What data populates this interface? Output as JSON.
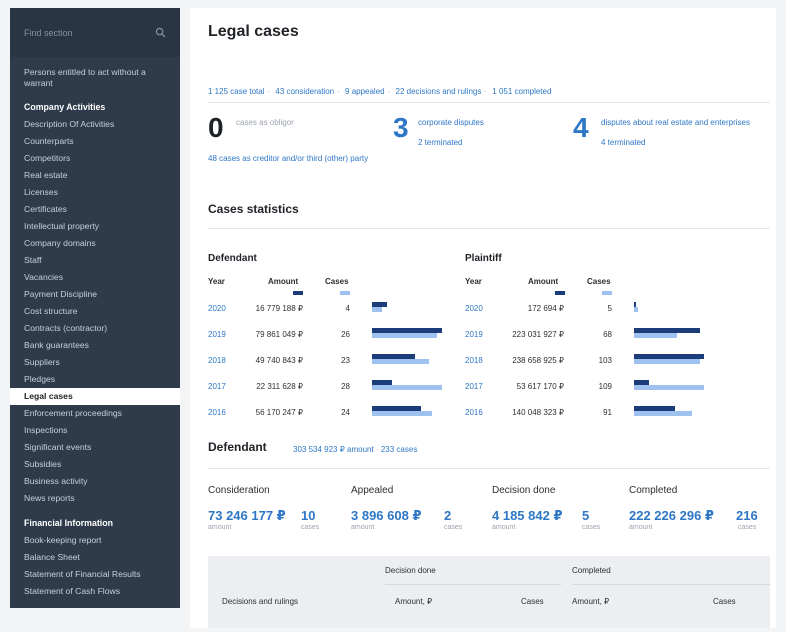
{
  "sidebar": {
    "search_placeholder": "Find section",
    "first_item": "Persons entitled to act without a warrant",
    "section1": "Company Activities",
    "items1": [
      "Description Of Activities",
      "Counterparts",
      "Competitors",
      "Real estate",
      "Licenses",
      "Certificates",
      "Intellectual property",
      "Company domains",
      "Staff",
      "Vacancies",
      "Payment Discipline",
      "Cost structure",
      "Contracts (contractor)",
      "Bank guarantees",
      "Suppliers",
      "Pledges",
      "Legal cases",
      "Enforcement proceedings",
      "Inspections",
      "Significant events",
      "Subsidies",
      "Business activity",
      "News reports"
    ],
    "active_item": "Legal cases",
    "section2": "Financial Information",
    "items2": [
      "Book-keeping report",
      "Balance Sheet",
      "Statement of Financial Results",
      "Statement of Cash Flows"
    ]
  },
  "main": {
    "title": "Legal cases",
    "summary": [
      "1 125 case total",
      "43 consideration",
      "9 appealed",
      "22 decisions and rulings",
      "1 051 completed"
    ],
    "obligor": {
      "count": "0",
      "label": "cases as obligor",
      "link": "48 cases as creditor and/or third (other) party"
    },
    "corporate": {
      "count": "3",
      "label": "corporate disputes",
      "sub": "2 terminated"
    },
    "realestate": {
      "count": "4",
      "label": "disputes about real estate and enterprises",
      "sub": "4 terminated"
    },
    "stats_title": "Cases statistics",
    "defendant": {
      "title": "Defendant",
      "headers": {
        "year": "Year",
        "amount": "Amount",
        "cases": "Cases"
      },
      "rows": [
        {
          "year": "2020",
          "amount": "16 779 188 ₽",
          "cases": "4",
          "amount_frac": 0.21,
          "cases_frac": 0.14
        },
        {
          "year": "2019",
          "amount": "79 861 049 ₽",
          "cases": "26",
          "amount_frac": 1.0,
          "cases_frac": 0.93
        },
        {
          "year": "2018",
          "amount": "49 740 843 ₽",
          "cases": "23",
          "amount_frac": 0.62,
          "cases_frac": 0.82
        },
        {
          "year": "2017",
          "amount": "22 311 628 ₽",
          "cases": "28",
          "amount_frac": 0.28,
          "cases_frac": 1.0
        },
        {
          "year": "2016",
          "amount": "56 170 247 ₽",
          "cases": "24",
          "amount_frac": 0.7,
          "cases_frac": 0.86
        }
      ]
    },
    "plaintiff": {
      "title": "Plaintiff",
      "headers": {
        "year": "Year",
        "amount": "Amount",
        "cases": "Cases"
      },
      "rows": [
        {
          "year": "2020",
          "amount": "172 694 ₽",
          "cases": "5",
          "amount_frac": 0.01,
          "cases_frac": 0.05
        },
        {
          "year": "2019",
          "amount": "223 031 927 ₽",
          "cases": "68",
          "amount_frac": 0.94,
          "cases_frac": 0.62
        },
        {
          "year": "2018",
          "amount": "238 658 925 ₽",
          "cases": "103",
          "amount_frac": 1.0,
          "cases_frac": 0.94
        },
        {
          "year": "2017",
          "amount": "53 617 170 ₽",
          "cases": "109",
          "amount_frac": 0.22,
          "cases_frac": 1.0
        },
        {
          "year": "2016",
          "amount": "140 048 323 ₽",
          "cases": "91",
          "amount_frac": 0.59,
          "cases_frac": 0.83
        }
      ]
    },
    "defendant_summary": {
      "title": "Defendant",
      "amount": "303 534 923 ₽ amount",
      "cases": "233 cases",
      "kpis": [
        {
          "label": "Consideration",
          "value": "73 246 177 ₽",
          "count": "10"
        },
        {
          "label": "Appealed",
          "value": "3 896 608 ₽",
          "count": "2"
        },
        {
          "label": "Decision done",
          "value": "4 185 842 ₽",
          "count": "5"
        },
        {
          "label": "Completed",
          "value": "222 226 296 ₽",
          "count": "216"
        }
      ],
      "amount_sub": "amount",
      "cases_sub": "cases"
    },
    "table": {
      "decision_done": "Decision done",
      "completed": "Completed",
      "row_label": "Decisions and rulings",
      "amount_col": "Amount, ₽",
      "cases_col": "Cases",
      "amount_col2": "Amount, ₽",
      "cases_col2": "Cases"
    }
  },
  "colors": {
    "dark_bar": "#1d3d7a",
    "light_bar": "#9fc1f0",
    "link": "#2e77c6",
    "sidebar": "#2f3b4a"
  }
}
